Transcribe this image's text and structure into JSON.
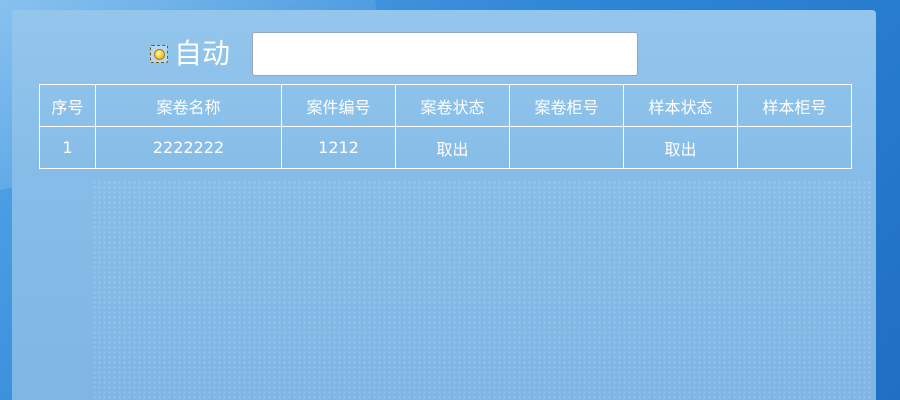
{
  "auto_mode": {
    "label": "自动",
    "selected": true,
    "input_value": ""
  },
  "table": {
    "columns": [
      "序号",
      "案卷名称",
      "案件编号",
      "案卷状态",
      "案卷柜号",
      "样本状态",
      "样本柜号"
    ],
    "rows": [
      [
        "1",
        "2222222",
        "1212",
        "取出",
        "",
        "取出",
        ""
      ]
    ]
  },
  "colors": {
    "background": "#2f86d6",
    "panel": "#86bde8",
    "table_border": "#ffffff",
    "text": "#ffffff"
  }
}
